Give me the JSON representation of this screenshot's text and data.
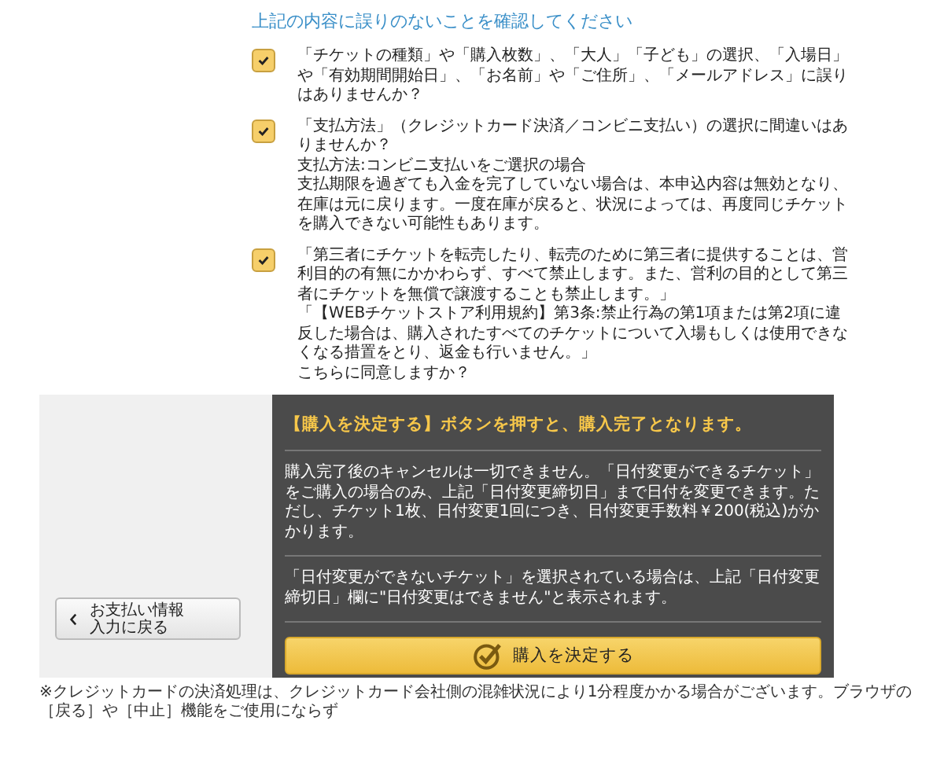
{
  "heading": "上記の内容に誤りのないことを確認してください",
  "checks": [
    {
      "checked": true,
      "paragraphs": [
        "「チケットの種類」や「購入枚数」、「大人」「子ども」の選択、「入場日」や「有効期間開始日」、「お名前」や「ご住所」、「メールアドレス」に誤りはありませんか？"
      ]
    },
    {
      "checked": true,
      "paragraphs": [
        "「支払方法」（クレジットカード決済／コンビニ支払い）の選択に間違いはありませんか？",
        "支払方法:コンビニ支払いをご選択の場合",
        "支払期限を過ぎても入金を完了していない場合は、本申込内容は無効となり、在庫は元に戻ります。一度在庫が戻ると、状況によっては、再度同じチケットを購入できない可能性もあります。"
      ]
    },
    {
      "checked": true,
      "paragraphs": [
        "「第三者にチケットを転売したり、転売のために第三者に提供することは、営利目的の有無にかかわらず、すべて禁止します。また、営利の目的として第三者にチケットを無償で譲渡することも禁止します。」",
        "「【WEBチケットストア利用規約】第3条:禁止行為の第1項または第2項に違反した場合は、購入されたすべてのチケットについて入場もしくは使用できなくなる措置をとり、返金も行いません。」",
        "こちらに同意しますか？"
      ]
    }
  ],
  "back_button": {
    "line_1": "お支払い情報",
    "line_2": "入力に戻る"
  },
  "panel": {
    "title": "【購入を決定する】ボタンを押すと、購入完了となります。",
    "notes": [
      "購入完了後のキャンセルは一切できません。「日付変更ができるチケット」をご購入の場合のみ、上記「日付変更締切日」まで日付を変更できます。ただし、チケット1枚、日付変更1回につき、日付変更手数料￥200(税込)がかかります。",
      "「日付変更ができないチケット」を選択されている場合は、上記「日付変更締切日」欄に\"日付変更はできません\"と表示されます。"
    ],
    "confirm_button": "購入を決定する"
  },
  "footnote": "※クレジットカードの決済処理は、クレジットカード会社側の混雑状況により1分程度かかる場合がございます。ブラウザの［戻る］や［中止］機能をご使用にならず"
}
